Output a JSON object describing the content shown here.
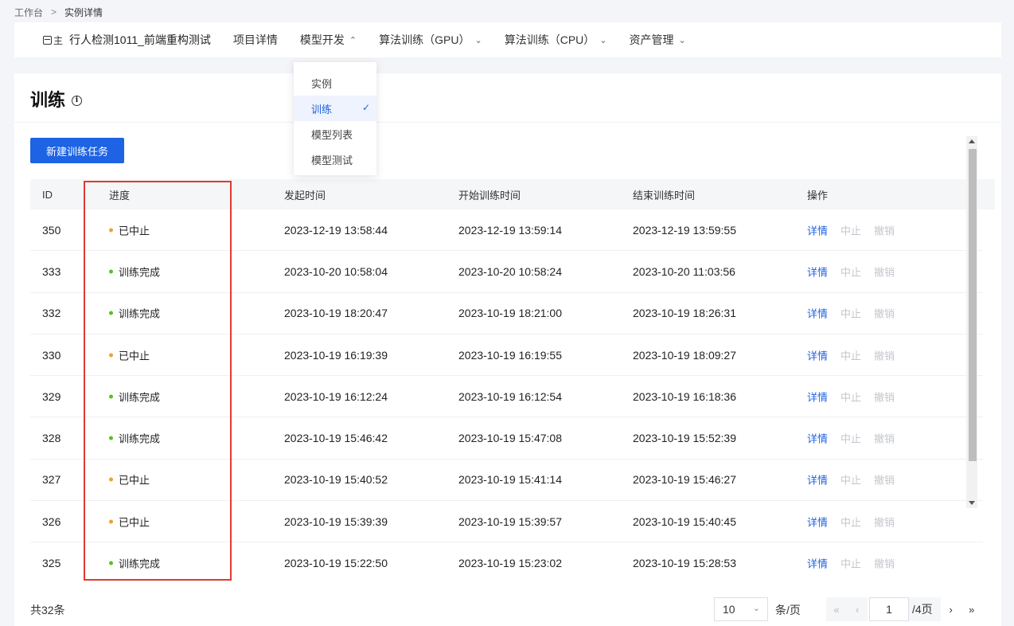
{
  "breadcrumb": {
    "root": "工作台",
    "separator": ">",
    "current": "实例详情"
  },
  "nav": {
    "owner_label": "主",
    "project_name": "行人检测1011_前端重构测试",
    "items": [
      {
        "label": "项目详情",
        "chevron": ""
      },
      {
        "label": "模型开发",
        "chevron": "⌃"
      },
      {
        "label": "算法训练（GPU）",
        "chevron": "⌄"
      },
      {
        "label": "算法训练（CPU）",
        "chevron": "⌄"
      },
      {
        "label": "资产管理",
        "chevron": "⌄"
      }
    ]
  },
  "dropdown": {
    "items": [
      {
        "label": "实例",
        "selected": false
      },
      {
        "label": "训练",
        "selected": true
      },
      {
        "label": "模型列表",
        "selected": false
      },
      {
        "label": "模型测试",
        "selected": false
      }
    ],
    "check": "✓"
  },
  "page": {
    "title": "训练",
    "info_icon": "i",
    "new_button": "新建训练任务"
  },
  "table": {
    "headers": {
      "id": "ID",
      "progress": "进度",
      "launch": "发起时间",
      "start": "开始训练时间",
      "end": "结束训练时间",
      "ops": "操作"
    },
    "rows": [
      {
        "id": "350",
        "status": "已中止",
        "status_color": "#f0a030",
        "launch": "2023-12-19 13:58:44",
        "start": "2023-12-19 13:59:14",
        "end": "2023-12-19 13:59:55",
        "op_detail": "详情",
        "op_stop": "中止",
        "op_revoke": "撤销"
      },
      {
        "id": "333",
        "status": "训练完成",
        "status_color": "#52c41a",
        "launch": "2023-10-20 10:58:04",
        "start": "2023-10-20 10:58:24",
        "end": "2023-10-20 11:03:56",
        "op_detail": "详情",
        "op_stop": "中止",
        "op_revoke": "撤销"
      },
      {
        "id": "332",
        "status": "训练完成",
        "status_color": "#52c41a",
        "launch": "2023-10-19 18:20:47",
        "start": "2023-10-19 18:21:00",
        "end": "2023-10-19 18:26:31",
        "op_detail": "详情",
        "op_stop": "中止",
        "op_revoke": "撤销"
      },
      {
        "id": "330",
        "status": "已中止",
        "status_color": "#f0a030",
        "launch": "2023-10-19 16:19:39",
        "start": "2023-10-19 16:19:55",
        "end": "2023-10-19 18:09:27",
        "op_detail": "详情",
        "op_stop": "中止",
        "op_revoke": "撤销"
      },
      {
        "id": "329",
        "status": "训练完成",
        "status_color": "#52c41a",
        "launch": "2023-10-19 16:12:24",
        "start": "2023-10-19 16:12:54",
        "end": "2023-10-19 16:18:36",
        "op_detail": "详情",
        "op_stop": "中止",
        "op_revoke": "撤销"
      },
      {
        "id": "328",
        "status": "训练完成",
        "status_color": "#52c41a",
        "launch": "2023-10-19 15:46:42",
        "start": "2023-10-19 15:47:08",
        "end": "2023-10-19 15:52:39",
        "op_detail": "详情",
        "op_stop": "中止",
        "op_revoke": "撤销"
      },
      {
        "id": "327",
        "status": "已中止",
        "status_color": "#f0a030",
        "launch": "2023-10-19 15:40:52",
        "start": "2023-10-19 15:41:14",
        "end": "2023-10-19 15:46:27",
        "op_detail": "详情",
        "op_stop": "中止",
        "op_revoke": "撤销"
      },
      {
        "id": "326",
        "status": "已中止",
        "status_color": "#f0a030",
        "launch": "2023-10-19 15:39:39",
        "start": "2023-10-19 15:39:57",
        "end": "2023-10-19 15:40:45",
        "op_detail": "详情",
        "op_stop": "中止",
        "op_revoke": "撤销"
      },
      {
        "id": "325",
        "status": "训练完成",
        "status_color": "#52c41a",
        "launch": "2023-10-19 15:22:50",
        "start": "2023-10-19 15:23:02",
        "end": "2023-10-19 15:28:53",
        "op_detail": "详情",
        "op_stop": "中止",
        "op_revoke": "撤销"
      }
    ]
  },
  "footer": {
    "total": "共32条",
    "page_size": "10",
    "page_size_chevron": "⌄",
    "per_page": "条/页",
    "first": "«",
    "prev": "‹",
    "current_page": "1",
    "total_pages": "/4页",
    "next": "›",
    "last": "»"
  }
}
